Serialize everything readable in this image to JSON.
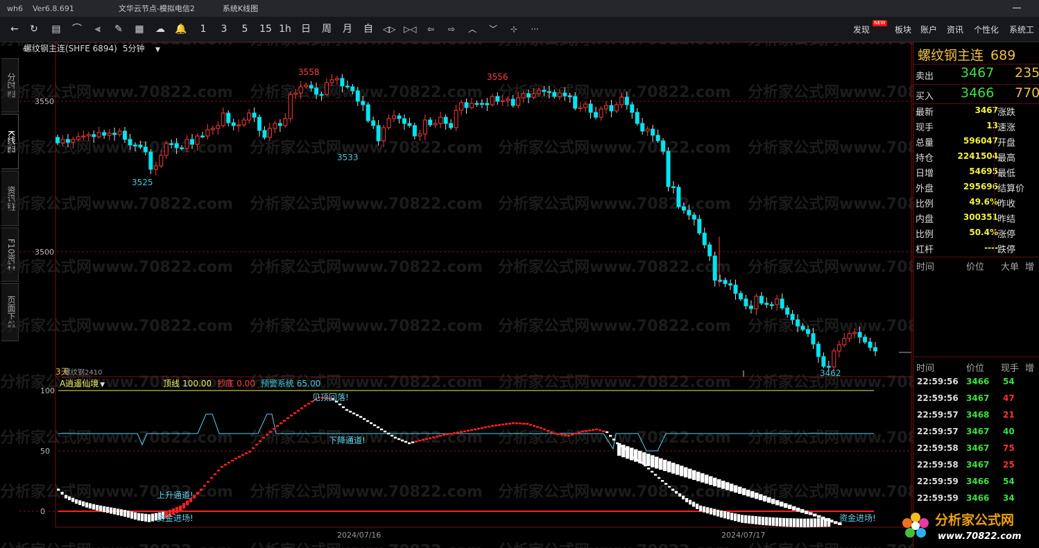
{
  "titlebar": {
    "app": "wh6",
    "version": "Ver6.8.691",
    "node": "文华云节点-模拟电信2",
    "menu": "系统K线图"
  },
  "toolbar": {
    "tools": [
      {
        "name": "back-arrow-icon",
        "label": "←"
      },
      {
        "name": "refresh-icon",
        "label": "↻"
      },
      {
        "name": "quote-list-icon",
        "label": "▤"
      },
      {
        "name": "line-chart-icon",
        "label": "⌒"
      },
      {
        "name": "kline-icon",
        "label": "⫷"
      },
      {
        "name": "draw-tool-icon",
        "label": "✎"
      },
      {
        "name": "indicator-icon",
        "label": "▦"
      },
      {
        "name": "cloud-icon",
        "label": "☁"
      },
      {
        "name": "bell-icon",
        "label": "🔔"
      }
    ],
    "periods": [
      "1",
      "3",
      "5",
      "15",
      "1h",
      "日",
      "周",
      "月",
      "自"
    ],
    "nav_tools": [
      {
        "name": "zoom-in-icon",
        "label": "◁▷"
      },
      {
        "name": "zoom-out-icon",
        "label": "▷◁"
      },
      {
        "name": "left-arrow-icon",
        "label": "⇦"
      },
      {
        "name": "right-arrow-icon",
        "label": "⇨"
      },
      {
        "name": "up-icon",
        "label": "︿"
      },
      {
        "name": "down-icon",
        "label": "﹀"
      },
      {
        "name": "crosshair-icon",
        "label": "⊹"
      },
      {
        "name": "more-icon",
        "label": "···"
      }
    ],
    "right_menu": [
      "发现",
      "板块",
      "账户",
      "资讯",
      "个性化",
      "系统工"
    ],
    "new_badge": "NEW"
  },
  "sidetabs": [
    "分时图",
    "K线图",
    "资讯链",
    "F10资料",
    "页面下单"
  ],
  "chart_header": {
    "contract": "螺纹钢主连(SHFE 6894)",
    "period": "5分钟"
  },
  "price_axis": [
    "3550",
    "3500"
  ],
  "price_annotations": [
    {
      "text": "3558",
      "color": "#ff4040"
    },
    {
      "text": "3556",
      "color": "#ff4040"
    },
    {
      "text": "3525",
      "color": "#40c8d8"
    },
    {
      "text": "3533",
      "color": "#40c8d8"
    },
    {
      "text": "3462",
      "color": "#40c8d8"
    }
  ],
  "subchart_label": "3天",
  "subchart_label2": "螺纹钢2410",
  "indicator": {
    "name": "A逍遥仙境",
    "items": [
      {
        "label": "顶线",
        "value": "100.00",
        "color": "#f0f060"
      },
      {
        "label": "抄底",
        "value": "0.00",
        "color": "#ff4040"
      },
      {
        "label": "预警系统",
        "value": "65.00",
        "color": "#40c8e0"
      }
    ],
    "axis": [
      "100",
      "50",
      "0"
    ],
    "annotations": [
      "见顶回落!",
      "下降通道!",
      "上升通道!",
      "资金进场!",
      "资金进场!"
    ]
  },
  "date_labels": [
    "2024/07/16",
    "2024/07/17"
  ],
  "watermark": "分析家公式网www.70822.com",
  "quote": {
    "title": "螺纹钢主连",
    "title_suffix": "689",
    "ask_label": "卖出",
    "ask_price": "3467",
    "ask_vol": "235",
    "bid_label": "买入",
    "bid_price": "3466",
    "bid_vol": "770",
    "rows": [
      {
        "label": "最新",
        "value": "3467",
        "label2": "涨跌"
      },
      {
        "label": "现手",
        "value": "13",
        "label2": "速涨"
      },
      {
        "label": "总量",
        "value": "596047",
        "label2": "开盘"
      },
      {
        "label": "持仓",
        "value": "2241504",
        "label2": "最高"
      },
      {
        "label": "日增",
        "value": "54695",
        "label2": "最低"
      },
      {
        "label": "外盘",
        "value": "295696",
        "label2": "结算价"
      },
      {
        "label": "比例",
        "value": "49.6%",
        "label2": "昨收"
      },
      {
        "label": "内盘",
        "value": "300351",
        "label2": "昨结"
      },
      {
        "label": "比例",
        "value": "50.4%",
        "label2": "涨停"
      },
      {
        "label": "杠杆",
        "value": "----",
        "label2": "跌停"
      }
    ],
    "bigorder_header": [
      "时间",
      "价位",
      "大单",
      "增"
    ],
    "tick_header": [
      "时间",
      "价位",
      "现手",
      "增"
    ],
    "ticks": [
      {
        "time": "22:59:56",
        "price": "3466",
        "vol": "54",
        "vcolor": "#3ce03c"
      },
      {
        "time": "22:59:56",
        "price": "3467",
        "vol": "47",
        "vcolor": "#ff3030"
      },
      {
        "time": "22:59:57",
        "price": "3468",
        "vol": "21",
        "vcolor": "#ff3030"
      },
      {
        "time": "22:59:57",
        "price": "3467",
        "vol": "40",
        "vcolor": "#3ce03c"
      },
      {
        "time": "22:59:58",
        "price": "3467",
        "vol": "75",
        "vcolor": "#ff3030"
      },
      {
        "time": "22:59:58",
        "price": "3467",
        "vol": "25",
        "vcolor": "#ff3030"
      },
      {
        "time": "22:59:59",
        "price": "3466",
        "vol": "54",
        "vcolor": "#3ce03c"
      },
      {
        "time": "22:59:59",
        "price": "3466",
        "vol": "34",
        "vcolor": "#3ce03c"
      }
    ]
  },
  "logo": {
    "name": "分析家公式网",
    "url": "www.70822.com"
  },
  "colors": {
    "up": "#ff3c3c",
    "down": "#00e5f0",
    "grid": "#7a1414",
    "yellow": "#f0c040"
  }
}
